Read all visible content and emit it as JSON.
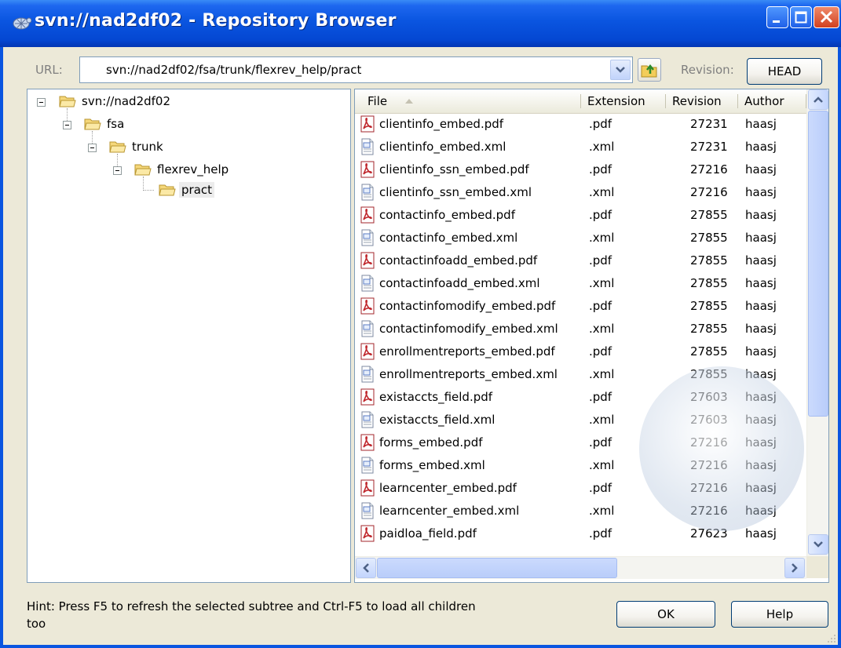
{
  "window": {
    "title": "svn://nad2df02 - Repository Browser",
    "controls": {
      "minimize": "minimize-icon",
      "maximize": "maximize-icon",
      "close": "close-icon"
    }
  },
  "toolbar": {
    "url_label": "URL:",
    "url_value": "svn://nad2df02/fsa/trunk/flexrev_help/pract",
    "revision_label": "Revision:",
    "revision_button": "HEAD"
  },
  "tree": {
    "nodes": [
      {
        "label": "svn://nad2df02",
        "level": 0,
        "expanded": true
      },
      {
        "label": "fsa",
        "level": 1,
        "expanded": true
      },
      {
        "label": "trunk",
        "level": 2,
        "expanded": true
      },
      {
        "label": "flexrev_help",
        "level": 3,
        "expanded": true
      },
      {
        "label": "pract",
        "level": 4,
        "selected": true
      }
    ]
  },
  "file_list": {
    "columns": [
      "File",
      "Extension",
      "Revision",
      "Author"
    ],
    "sort_column": "File",
    "rows": [
      {
        "file": "clientinfo_embed.pdf",
        "ext": ".pdf",
        "rev": "27231",
        "author": "haasj",
        "icon": "pdf-file-icon"
      },
      {
        "file": "clientinfo_embed.xml",
        "ext": ".xml",
        "rev": "27231",
        "author": "haasj",
        "icon": "xml-file-icon"
      },
      {
        "file": "clientinfo_ssn_embed.pdf",
        "ext": ".pdf",
        "rev": "27216",
        "author": "haasj",
        "icon": "pdf-file-icon"
      },
      {
        "file": "clientinfo_ssn_embed.xml",
        "ext": ".xml",
        "rev": "27216",
        "author": "haasj",
        "icon": "xml-file-icon"
      },
      {
        "file": "contactinfo_embed.pdf",
        "ext": ".pdf",
        "rev": "27855",
        "author": "haasj",
        "icon": "pdf-file-icon"
      },
      {
        "file": "contactinfo_embed.xml",
        "ext": ".xml",
        "rev": "27855",
        "author": "haasj",
        "icon": "xml-file-icon"
      },
      {
        "file": "contactinfoadd_embed.pdf",
        "ext": ".pdf",
        "rev": "27855",
        "author": "haasj",
        "icon": "pdf-file-icon"
      },
      {
        "file": "contactinfoadd_embed.xml",
        "ext": ".xml",
        "rev": "27855",
        "author": "haasj",
        "icon": "xml-file-icon"
      },
      {
        "file": "contactinfomodify_embed.pdf",
        "ext": ".pdf",
        "rev": "27855",
        "author": "haasj",
        "icon": "pdf-file-icon"
      },
      {
        "file": "contactinfomodify_embed.xml",
        "ext": ".xml",
        "rev": "27855",
        "author": "haasj",
        "icon": "xml-file-icon"
      },
      {
        "file": "enrollmentreports_embed.pdf",
        "ext": ".pdf",
        "rev": "27855",
        "author": "haasj",
        "icon": "pdf-file-icon"
      },
      {
        "file": "enrollmentreports_embed.xml",
        "ext": ".xml",
        "rev": "27855",
        "author": "haasj",
        "icon": "xml-file-icon"
      },
      {
        "file": "existaccts_field.pdf",
        "ext": ".pdf",
        "rev": "27603",
        "author": "haasj",
        "icon": "pdf-file-icon"
      },
      {
        "file": "existaccts_field.xml",
        "ext": ".xml",
        "rev": "27603",
        "author": "haasj",
        "icon": "xml-file-icon"
      },
      {
        "file": "forms_embed.pdf",
        "ext": ".pdf",
        "rev": "27216",
        "author": "haasj",
        "icon": "pdf-file-icon"
      },
      {
        "file": "forms_embed.xml",
        "ext": ".xml",
        "rev": "27216",
        "author": "haasj",
        "icon": "xml-file-icon"
      },
      {
        "file": "learncenter_embed.pdf",
        "ext": ".pdf",
        "rev": "27216",
        "author": "haasj",
        "icon": "pdf-file-icon"
      },
      {
        "file": "learncenter_embed.xml",
        "ext": ".xml",
        "rev": "27216",
        "author": "haasj",
        "icon": "xml-file-icon"
      },
      {
        "file": "paidloa_field.pdf",
        "ext": ".pdf",
        "rev": "27623",
        "author": "haasj",
        "icon": "pdf-file-icon"
      }
    ]
  },
  "footer": {
    "hint": "Hint: Press F5 to refresh the selected subtree and Ctrl-F5 to load all children too",
    "ok_button": "OK",
    "help_button": "Help"
  },
  "colors": {
    "title_bar": "#0a55e0",
    "dialog_face": "#ece9d8",
    "field_border": "#7f9db9",
    "pdf_icon": "#c0272d"
  }
}
